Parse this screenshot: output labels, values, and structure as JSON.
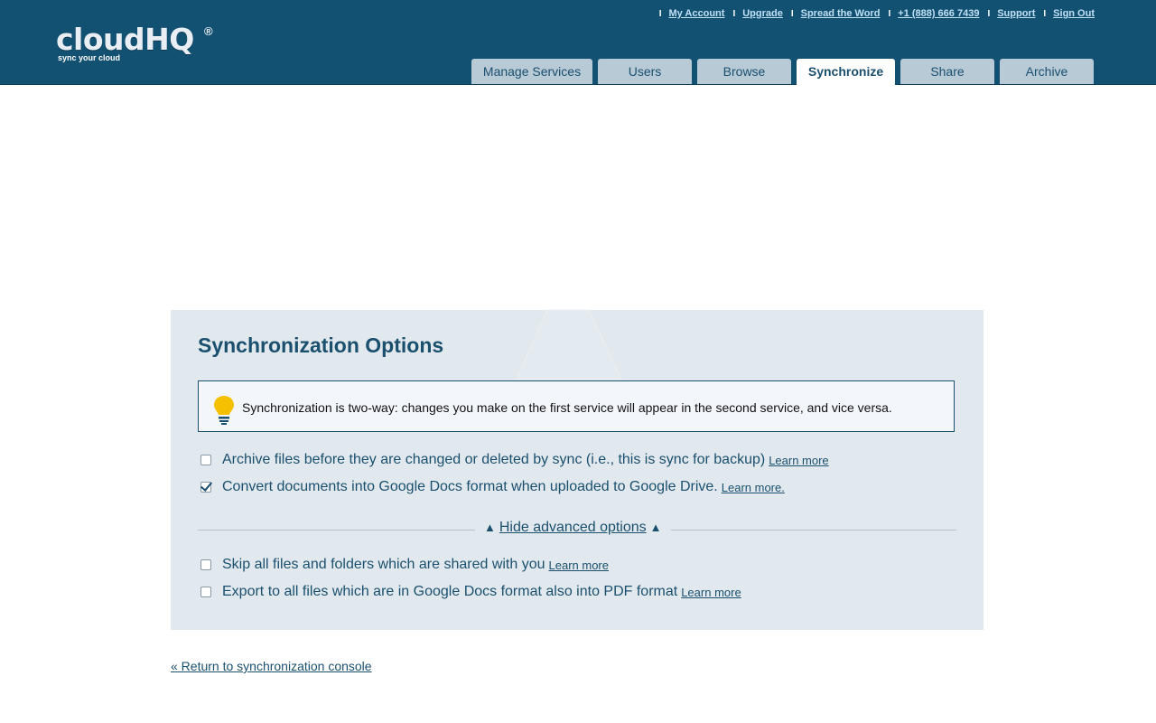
{
  "header": {
    "logo_text": "cloudHQ",
    "logo_registered": "®",
    "logo_tagline": "sync your cloud",
    "top_links": [
      "My Account",
      "Upgrade",
      "Spread the Word",
      "+1 (888) 666 7439",
      "Support",
      "Sign Out"
    ],
    "top_link_separator": "I",
    "tabs": [
      {
        "label": "Manage Services",
        "active": false
      },
      {
        "label": "Users",
        "active": false
      },
      {
        "label": "Browse",
        "active": false
      },
      {
        "label": "Synchronize",
        "active": true
      },
      {
        "label": "Share",
        "active": false
      },
      {
        "label": "Archive",
        "active": false
      }
    ]
  },
  "panel": {
    "title": "Synchronization Options",
    "tip_icon": "lightbulb-icon",
    "tip_text": "Synchronization is two-way: changes you make on the first service will appear in the second service, and vice versa.",
    "options": [
      {
        "label": "Archive files before they are changed or deleted by sync (i.e., this is sync for backup)",
        "learn_more": "Learn more",
        "checked": false
      },
      {
        "label": "Convert documents into Google Docs format when uploaded to Google Drive.",
        "learn_more": "Learn more.",
        "checked": true
      }
    ],
    "advanced_toggle": {
      "label": "Hide advanced options",
      "arrow": "▲"
    },
    "advanced_options": [
      {
        "label": "Skip all files and folders which are shared with you",
        "learn_more": "Learn more",
        "checked": false
      },
      {
        "label": "Export to all files which are in Google Docs format also into PDF format",
        "learn_more": "Learn more",
        "checked": false
      }
    ]
  },
  "footer": {
    "return_link": "« Return to synchronization console"
  },
  "colors": {
    "header_bg": "#135173",
    "tab_bg": "#b7cad6",
    "panel_bg": "#e1e9ee",
    "text_primary": "#1b4f6e",
    "link_light": "#bfe0f5",
    "bulb_yellow": "#f5c000"
  }
}
